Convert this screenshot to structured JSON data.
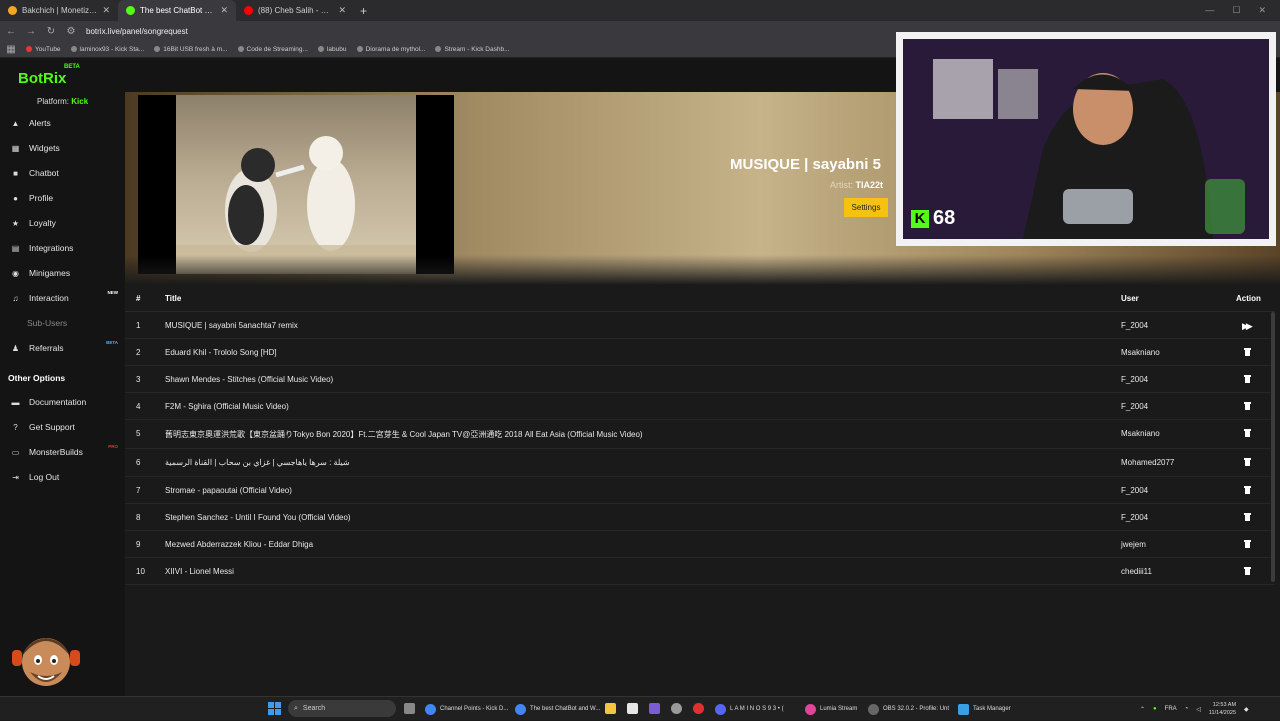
{
  "browser": {
    "tabs": [
      {
        "title": "Bakchich | Monetization for af...",
        "favicon_color": "#f5a623"
      },
      {
        "title": "The best ChatBot and Widg...",
        "favicon_color": "#53fc18"
      },
      {
        "title": "(88) Cheb Salih - Khali ya khali...",
        "favicon_color": "#ff0000"
      }
    ],
    "url": "botrix.live/panel/songrequest",
    "bookmarks": [
      "YouTube",
      "laminox93 - Kick Sta...",
      "16Bit USB fresh à m...",
      "Code de Streaming...",
      "labubu",
      "Diorama de mythol...",
      "Stream - Kick Dashb..."
    ]
  },
  "site": {
    "logo": "BotRix",
    "logo_badge": "BETA",
    "platform_label": "Platform:",
    "platform_value": "Kick"
  },
  "sidebar": {
    "items": [
      {
        "label": "Alerts",
        "icon": "bell-icon"
      },
      {
        "label": "Widgets",
        "icon": "grid-icon"
      },
      {
        "label": "Chatbot",
        "icon": "chat-icon"
      },
      {
        "label": "Profile",
        "icon": "user-icon"
      },
      {
        "label": "Loyalty",
        "icon": "star-icon"
      },
      {
        "label": "Integrations",
        "icon": "plug-icon"
      },
      {
        "label": "Minigames",
        "icon": "gamepad-icon"
      },
      {
        "label": "Interaction",
        "icon": "music-icon",
        "badge": "NEW"
      },
      {
        "label": "Sub-Users",
        "icon": "",
        "muted": true
      },
      {
        "label": "Referrals",
        "icon": "users-icon",
        "badge": "BETA"
      }
    ],
    "other_options_title": "Other Options",
    "other_items": [
      {
        "label": "Documentation",
        "icon": "book-icon"
      },
      {
        "label": "Get Support",
        "icon": "help-icon"
      },
      {
        "label": "MonsterBuilds",
        "icon": "monitor-icon",
        "badge": "PRO"
      },
      {
        "label": "Log Out",
        "icon": "logout-icon"
      }
    ]
  },
  "now_playing": {
    "title": "MUSIQUE | sayabni 5",
    "artist_label": "Artist:",
    "artist": "TIA22t",
    "settings_label": "Settings"
  },
  "webcam": {
    "kick_count": "68"
  },
  "queue": {
    "headers": {
      "num": "#",
      "title": "Title",
      "user": "User",
      "action": "Action"
    },
    "rows": [
      {
        "num": "1",
        "title": "MUSIQUE | sayabni 5anachta7 remix",
        "user": "F_2004",
        "action": "skip"
      },
      {
        "num": "2",
        "title": "Eduard Khil - Trololo Song [HD]",
        "user": "Msakniano",
        "action": "delete"
      },
      {
        "num": "3",
        "title": "Shawn Mendes - Stitches (Official Music Video)",
        "user": "F_2004",
        "action": "delete"
      },
      {
        "num": "4",
        "title": "F2M - Sghira (Official Music Video)",
        "user": "F_2004",
        "action": "delete"
      },
      {
        "num": "5",
        "title": "舊明志東京奧運洪荒歌【東京盆踊りTokyo Bon 2020】Ft.二宮芽生 & Cool Japan TV@亞洲通吃 2018 All Eat Asia (Official Music Video)",
        "user": "Msakniano",
        "action": "delete"
      },
      {
        "num": "6",
        "title": "شيلة : سرها ياهاجسي | غزاي بن سحاب | القناة الرسمية",
        "user": "Mohamed2077",
        "action": "delete"
      },
      {
        "num": "7",
        "title": "Stromae - papaoutai (Official Video)",
        "user": "F_2004",
        "action": "delete"
      },
      {
        "num": "8",
        "title": "Stephen Sanchez - Until I Found You (Official Video)",
        "user": "F_2004",
        "action": "delete"
      },
      {
        "num": "9",
        "title": "Mezwed Abderrazzek Kliou - Eddar Dhiga",
        "user": "jwejem",
        "action": "delete"
      },
      {
        "num": "10",
        "title": "XIIVI - Lionel Messi",
        "user": "chediii11",
        "action": "delete"
      }
    ]
  },
  "taskbar": {
    "search_placeholder": "Search",
    "apps": [
      {
        "label": "Channel Points - Kick D...",
        "color": "#4285f4"
      },
      {
        "label": "The best ChatBot and W...",
        "color": "#4285f4"
      },
      {
        "label": "L A M I N O S 9 3 • (",
        "color": "#5865f2"
      },
      {
        "label": "Lumia Stream",
        "color": "#e0459a"
      },
      {
        "label": "OBS 32.0.2 - Profile: Unt",
        "color": "#666666"
      },
      {
        "label": "Task Manager",
        "color": "#3aa0e6"
      }
    ],
    "lang": "FRA",
    "time": "12:53 AM",
    "date": "11/14/2025"
  }
}
